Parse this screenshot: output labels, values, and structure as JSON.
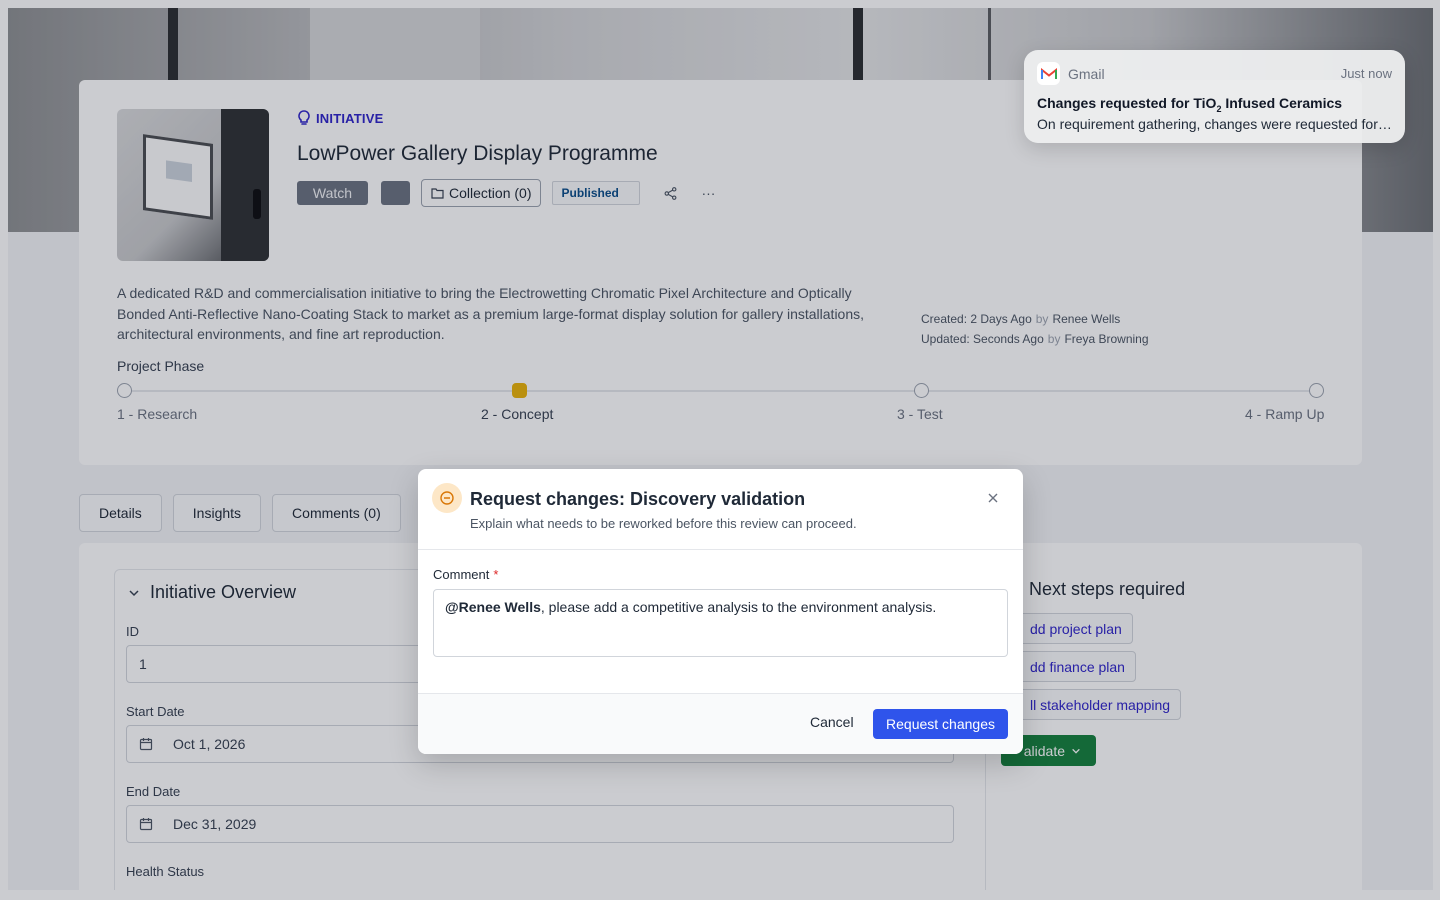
{
  "initiative": {
    "tag": "INITIATIVE",
    "title": "LowPower Gallery Display Programme",
    "watch_label": "Watch",
    "collection_label": "Collection (0)",
    "status_badge": "Published",
    "more_label": "···",
    "description": "A dedicated R&D and commercialisation initiative to bring the Electrowetting Chromatic Pixel Architecture and Optically Bonded Anti-Reflective Nano-Coating Stack to market as a premium large-format display solution for gallery installations, architectural environments, and fine art reproduction.",
    "created_label": "Created:",
    "created_value": "2 Days Ago",
    "created_by": "Renee Wells",
    "updated_label": "Updated:",
    "updated_value": "Seconds Ago",
    "updated_by": "Freya Browning",
    "by": "by"
  },
  "phase": {
    "title": "Project Phase",
    "steps": [
      {
        "label": "1 - Research",
        "active": false
      },
      {
        "label": "2 - Concept",
        "active": true
      },
      {
        "label": "3 - Test",
        "active": false
      },
      {
        "label": "4 - Ramp Up",
        "active": false
      }
    ]
  },
  "tabs": [
    "Details",
    "Insights",
    "Comments (0)"
  ],
  "overview": {
    "title": "Initiative Overview",
    "id_label": "ID",
    "id_value": "1",
    "start_label": "Start Date",
    "start_value": "Oct 1, 2026",
    "end_label": "End Date",
    "end_value": "Dec 31, 2029",
    "health_label": "Health Status"
  },
  "next_steps": {
    "title": "Next steps required",
    "items": [
      "dd project plan",
      "dd finance plan",
      "ll stakeholder mapping"
    ],
    "validate_label": "alidate"
  },
  "modal": {
    "title": "Request changes: Discovery validation",
    "subtitle": "Explain what needs to be reworked before this review can proceed.",
    "comment_label": "Comment",
    "required_mark": "*",
    "mention": "@Renee Wells",
    "comment_text": ", please add a competitive analysis to the environment analysis.",
    "cancel_label": "Cancel",
    "submit_label": "Request changes"
  },
  "notification": {
    "app": "Gmail",
    "time": "Just now",
    "title_prefix": "Changes requested for TiO",
    "title_sub": "2",
    "title_suffix": " Infused Ceramics",
    "body": "On requirement gathering, changes were requested for the Discovery validation review."
  },
  "colors": {
    "accent": "#2f54eb",
    "tag": "#2f24c9",
    "phase_active": "#eab308",
    "validate": "#15803d"
  }
}
